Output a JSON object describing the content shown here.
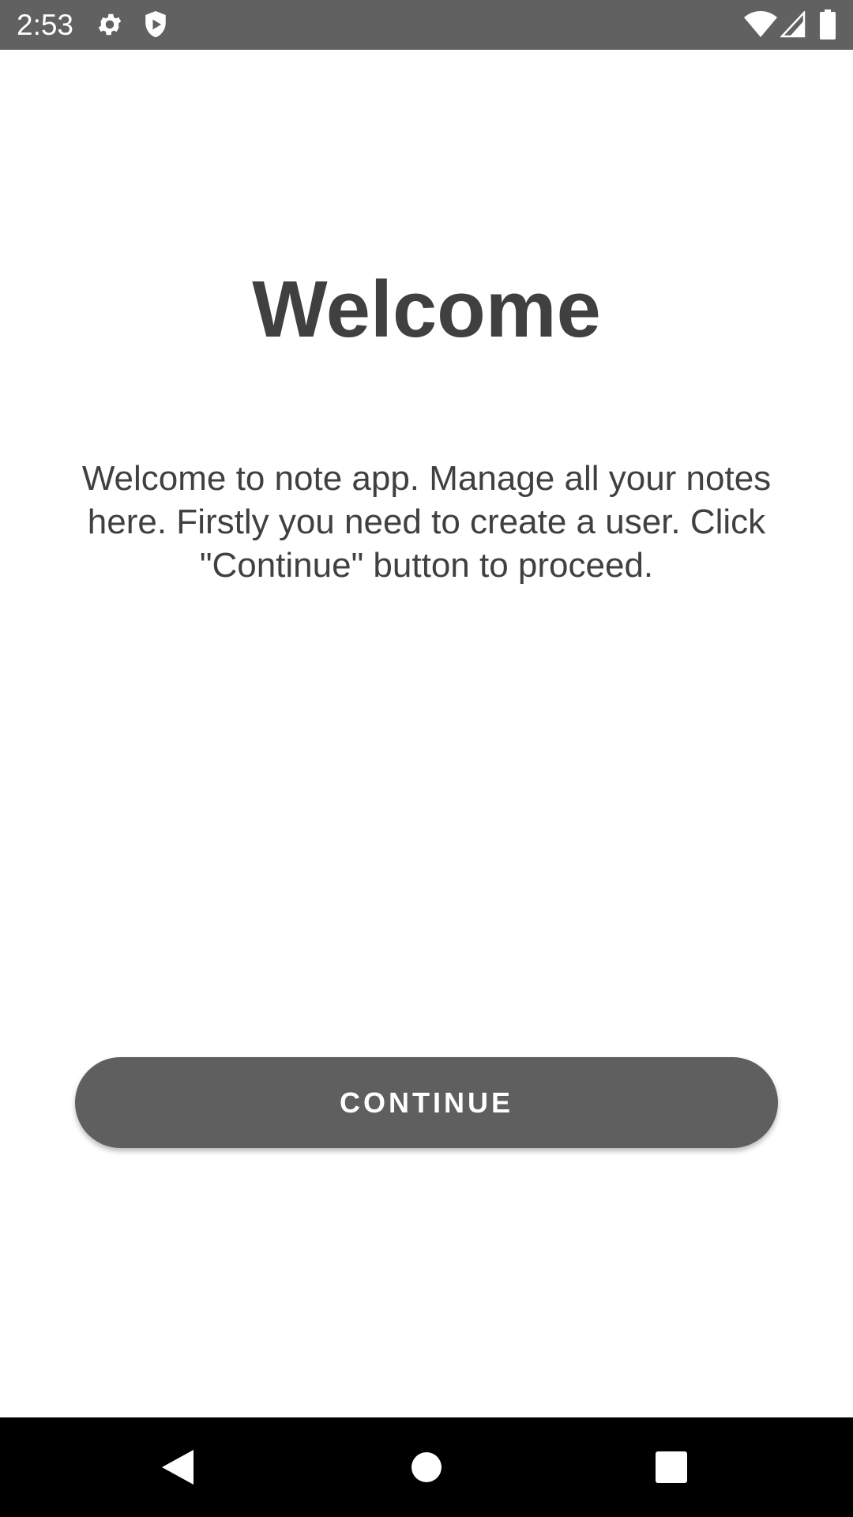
{
  "status_bar": {
    "time": "2:53",
    "icons": [
      "gear-icon",
      "shield-icon",
      "wifi-icon",
      "cell-signal-icon",
      "battery-icon"
    ],
    "background": "#616161"
  },
  "main": {
    "title": "Welcome",
    "description": "Welcome to note app. Manage all your notes here. Firstly you need to create a user. Click \"Continue\" button to proceed.",
    "text_color": "#404040"
  },
  "continue_button": {
    "label": "CONTINUE",
    "background": "#5f5f5f"
  },
  "nav_bar": {
    "buttons": [
      "back-icon",
      "home-icon",
      "recents-icon"
    ],
    "background": "#000000"
  }
}
